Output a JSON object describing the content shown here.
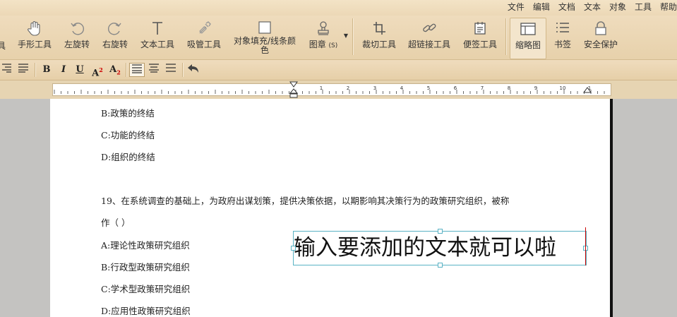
{
  "menu": [
    "文件",
    "编辑",
    "文档",
    "文本",
    "对象",
    "工具",
    "帮助"
  ],
  "toolbar": {
    "partial_label": "具",
    "hand": "手形工具",
    "rotate_left": "左旋转",
    "rotate_right": "右旋转",
    "text_tool": "文本工具",
    "eyedropper": "吸管工具",
    "fill_line1": "对象填充/线条颜",
    "fill_line2": "色",
    "stamp": "图章",
    "stamp_shortcut": "(S)",
    "crop": "裁切工具",
    "hyperlink": "超链接工具",
    "note": "便签工具",
    "thumbnail": "缩略图",
    "bookmark": "书签",
    "security": "安全保护"
  },
  "format": {
    "bold": "B",
    "italic": "I",
    "underline": "U",
    "superscript": "A",
    "superscript_mark": "2",
    "subscript": "A",
    "subscript_mark": "2"
  },
  "ruler": {
    "ticks": [
      "1",
      "2",
      "3",
      "4",
      "5",
      "6",
      "7",
      "8",
      "9",
      "10",
      "1"
    ]
  },
  "document": {
    "lines": [
      "B:政策的终结",
      "C:功能的终结",
      "D:组织的终结",
      "19、在系统调查的基础上，为政府出谋划策，提供决策依据，以期影响其决策行为的政策研究组织，被称",
      "作（ ）",
      "A:理论性政策研究组织",
      "B:行政型政策研究组织",
      "C:学术型政策研究组织",
      "D:应用性政策研究组织"
    ],
    "textbox_text": "输入要添加的文本就可以啦"
  }
}
